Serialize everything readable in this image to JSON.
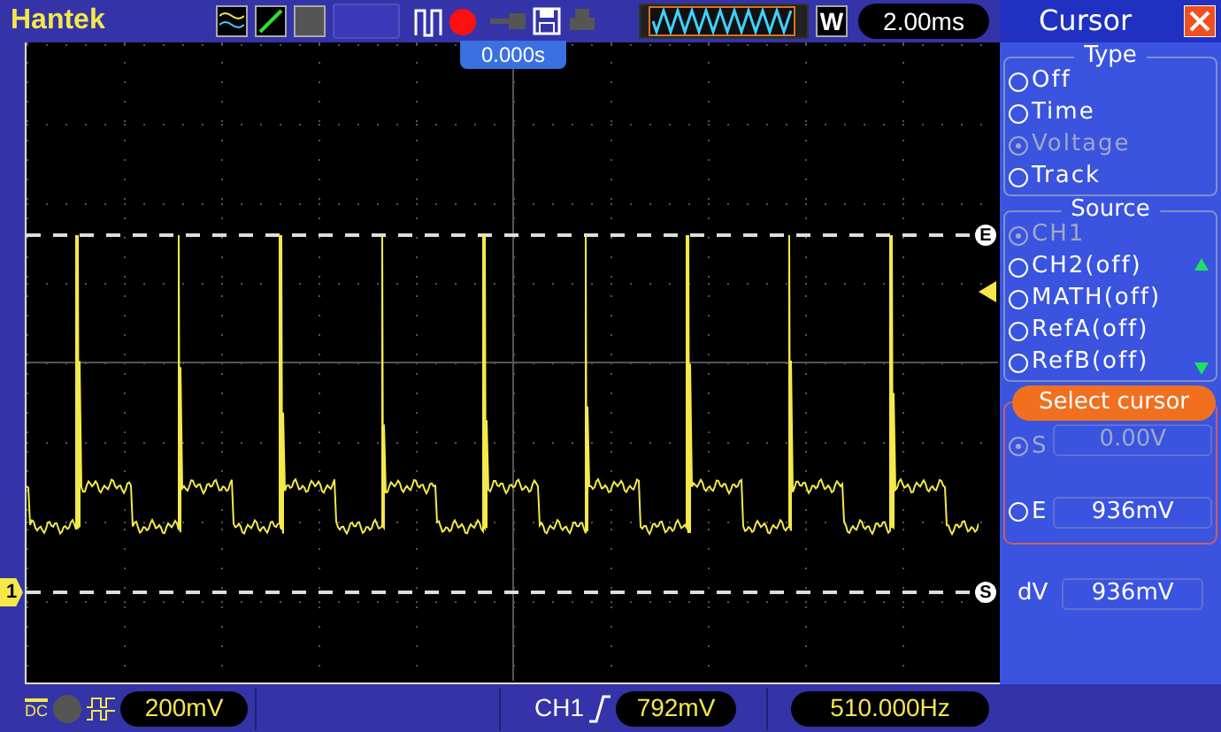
{
  "top_bar": {
    "brand": "Hantek",
    "mode": "W",
    "timebase": "2.00ms"
  },
  "scope": {
    "trigger_position": "0.000s",
    "channel_marker": "1",
    "cursor_markers": [
      {
        "label": "E",
        "kind": "upper"
      },
      {
        "label": "S",
        "kind": "lower"
      }
    ]
  },
  "panel": {
    "title": "Cursor",
    "type_group": {
      "title": "Type",
      "options": [
        {
          "label": "Off",
          "selected": false
        },
        {
          "label": "Time",
          "selected": false
        },
        {
          "label": "Voltage",
          "selected": true
        },
        {
          "label": "Track",
          "selected": false
        }
      ]
    },
    "source_group": {
      "title": "Source",
      "options": [
        {
          "label": "CH1",
          "selected": true
        },
        {
          "label": "CH2(off)",
          "selected": false
        },
        {
          "label": "MATH(off)",
          "selected": false
        },
        {
          "label": "RefA(off)",
          "selected": false
        },
        {
          "label": "RefB(off)",
          "selected": false
        }
      ]
    },
    "select_group": {
      "title": "Select cursor",
      "cursors": [
        {
          "label": "S",
          "value": "0.00V",
          "selected": true
        },
        {
          "label": "E",
          "value": "936mV",
          "selected": false
        }
      ]
    },
    "delta": {
      "label": "dV",
      "value": "936mV"
    }
  },
  "status_bar": {
    "coupling": "DC",
    "volts_per_div": "200mV",
    "trigger_source": "CH1",
    "trigger_level": "792mV",
    "frequency": "510.000Hz"
  }
}
